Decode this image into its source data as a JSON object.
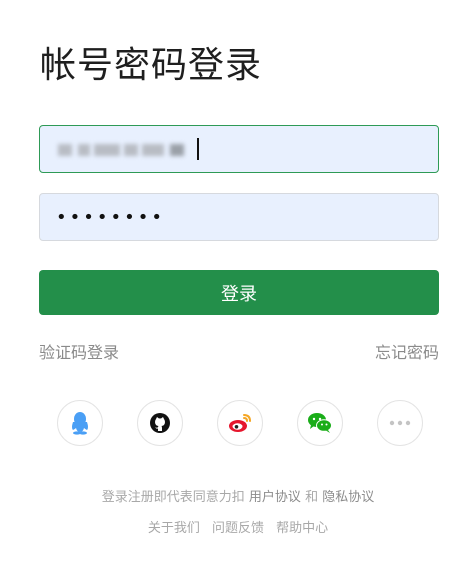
{
  "page": {
    "title": "帐号密码登录"
  },
  "form": {
    "password_mask": "••••••••",
    "login_label": "登录"
  },
  "links": {
    "sms_login": "验证码登录",
    "forgot_password": "忘记密码"
  },
  "social": {
    "items": [
      {
        "name": "qq-icon",
        "color": "#4a9ff5"
      },
      {
        "name": "github-icon",
        "color": "#111111"
      },
      {
        "name": "weibo-icon",
        "color": "#e6162d"
      },
      {
        "name": "wechat-icon",
        "color": "#1aad19"
      },
      {
        "name": "more-icon",
        "color": "#c4c4c4"
      }
    ]
  },
  "footer": {
    "agreement_prefix": "登录注册即代表同意力扣",
    "user_agreement": "用户协议",
    "and": "和",
    "privacy_agreement": "隐私协议",
    "about": "关于我们",
    "feedback": "问题反馈",
    "help": "帮助中心"
  },
  "colors": {
    "primary_green": "#238f4a",
    "input_bg": "#e8f0fe"
  }
}
